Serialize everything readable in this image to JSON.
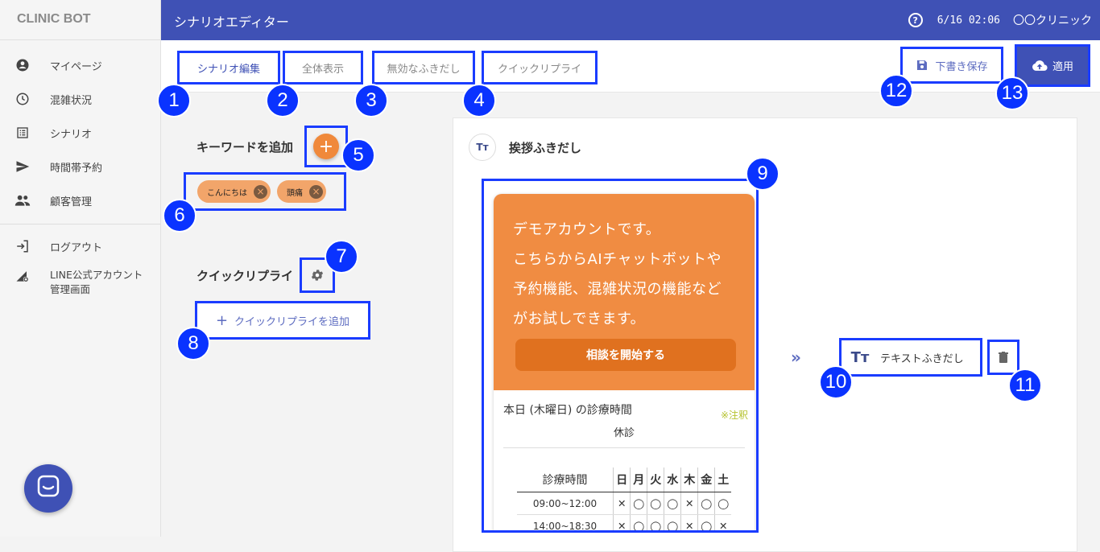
{
  "app": {
    "brand": "CLINIC BOT",
    "page_title": "シナリオエディター",
    "datetime": "6/16 02:06",
    "clinic_name": "〇〇クリニック",
    "help_glyph": "?"
  },
  "sidebar": {
    "items": [
      {
        "label": "マイページ",
        "icon": "account-circle-icon"
      },
      {
        "label": "混雑状況",
        "icon": "clock-icon"
      },
      {
        "label": "シナリオ",
        "icon": "list-icon"
      },
      {
        "label": "時間帯予約",
        "icon": "send-icon"
      },
      {
        "label": "顧客管理",
        "icon": "people-icon"
      }
    ],
    "logout": "ログアウト",
    "line_admin": "LINE公式アカウント\n管理画面"
  },
  "tabs": [
    {
      "label": "シナリオ編集",
      "active": true
    },
    {
      "label": "全体表示",
      "active": false
    },
    {
      "label": "無効なふきだし",
      "active": false
    },
    {
      "label": "クイックリプライ",
      "active": false
    }
  ],
  "actions": {
    "draft_label": "下書き保存",
    "apply_label": "適用"
  },
  "keywords": {
    "title": "キーワードを追加",
    "add_glyph": "+",
    "chips": [
      {
        "label": "こんにちは",
        "remove_glyph": "×"
      },
      {
        "label": "頭痛",
        "remove_glyph": "×"
      }
    ]
  },
  "quick_reply": {
    "title": "クイックリプライ",
    "add_label": "クイックリプライを追加",
    "add_glyph": "+"
  },
  "greeting_bubble": {
    "title": "挨拶ふきだし",
    "icon_text": "Tт",
    "card": {
      "message_lines": [
        "デモアカウントです。",
        "こちらからAIチャットボットや",
        "予約機能、混雑状況の機能など",
        "がお試しできます。"
      ],
      "cta": "相談を開始する",
      "today_label": "本日 (木曜日) の診療時間",
      "note": "※注釈",
      "today_status": "休診",
      "schedule": {
        "header": [
          "診療時間",
          "日",
          "月",
          "火",
          "水",
          "木",
          "金",
          "土"
        ],
        "rows": [
          [
            "09:00~12:00",
            "✕",
            "◯",
            "◯",
            "◯",
            "✕",
            "◯",
            "◯"
          ],
          [
            "14:00~18:30",
            "✕",
            "◯",
            "◯",
            "◯",
            "✕",
            "◯",
            "✕"
          ]
        ]
      }
    }
  },
  "next_bubble": {
    "arrow": "»",
    "icon_text": "Tт",
    "label": "テキストふきだし"
  },
  "annotations": [
    "1",
    "2",
    "3",
    "4",
    "5",
    "6",
    "7",
    "8",
    "9",
    "10",
    "11",
    "12",
    "13"
  ],
  "colors": {
    "primary": "#3f51b5",
    "accent_orange": "#f08c42",
    "annotation_blue": "#0a33ff"
  }
}
